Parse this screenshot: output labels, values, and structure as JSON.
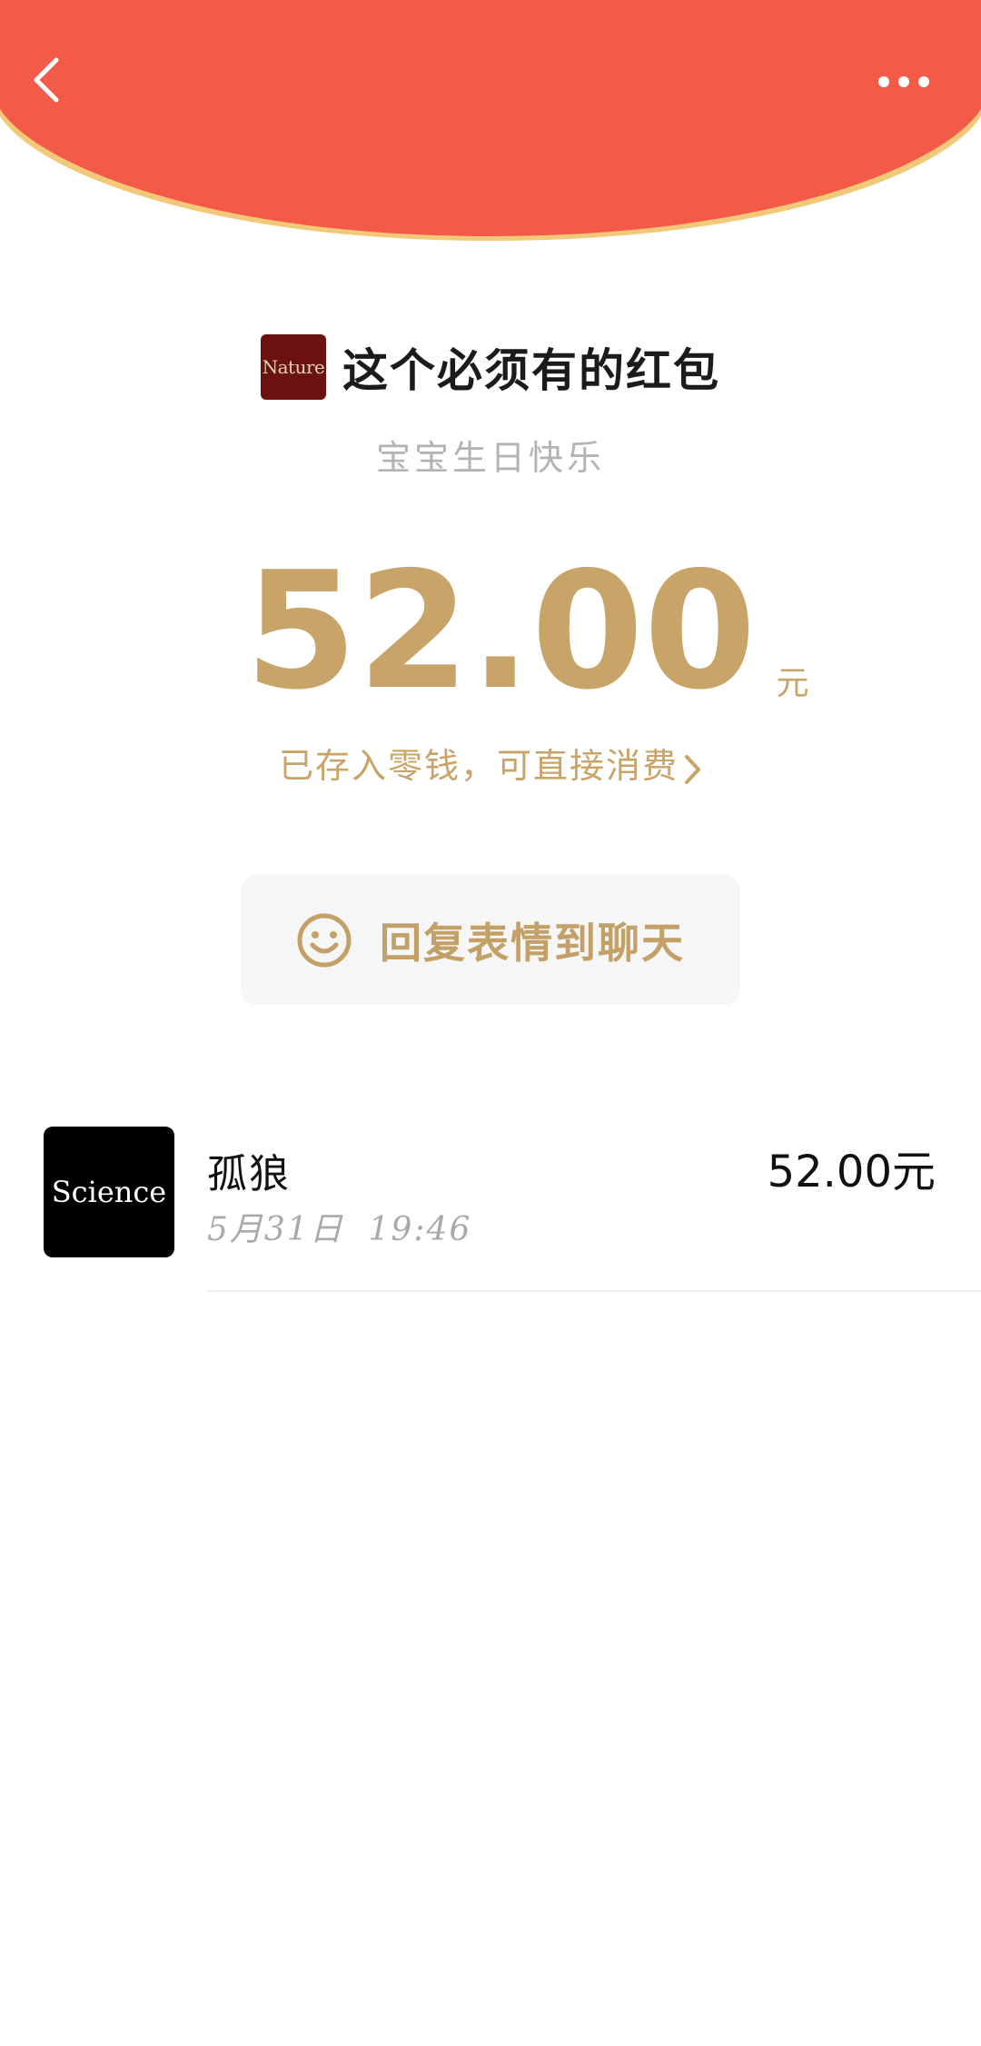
{
  "header": {
    "back_icon": "chevron-left-icon",
    "more_icon": "more-dots-icon",
    "color": "#f45a48",
    "border_color": "#f2c979"
  },
  "envelope": {
    "sender_avatar_text": "Nature",
    "title": "这个必须有的红包",
    "subtitle": "宝宝生日快乐",
    "amount": "52.00",
    "unit": "元",
    "stored_text": "已存入零钱，可直接消费",
    "accent_color": "#c8a468"
  },
  "reply_button": {
    "icon": "smile-icon",
    "label": "回复表情到聊天"
  },
  "records": [
    {
      "avatar_text": "Science",
      "name": "孤狼",
      "time": "5月31日  19:46",
      "amount": "52.00元"
    }
  ]
}
